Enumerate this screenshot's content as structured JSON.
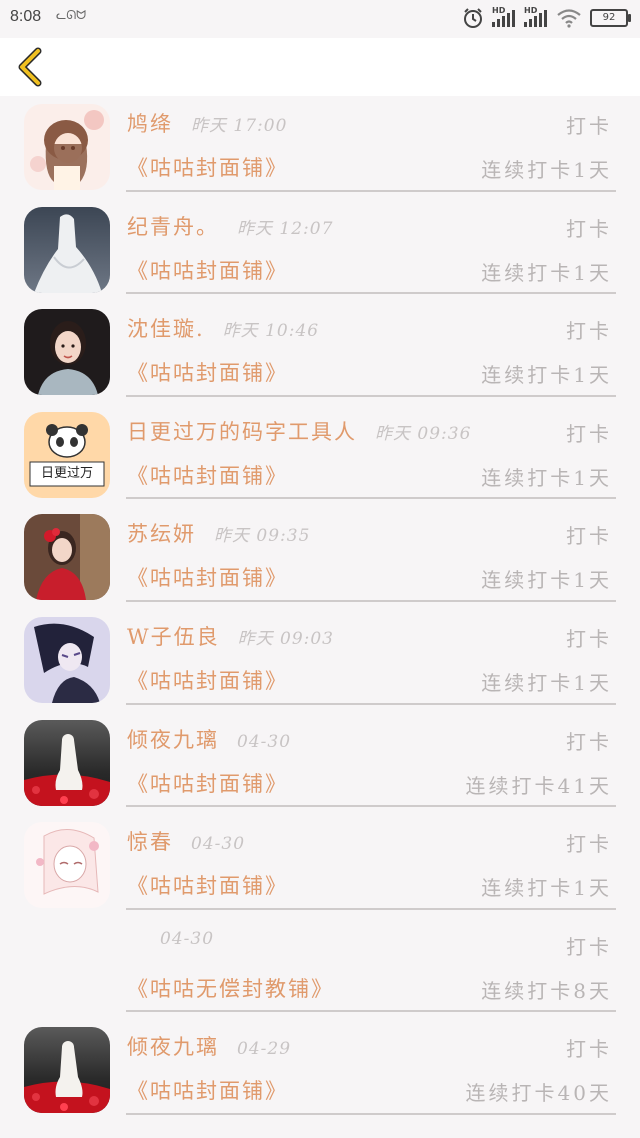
{
  "status_bar": {
    "time": "8:08",
    "notification_icon": "cat-notification-icon",
    "battery": "92",
    "icons": [
      "alarm-icon",
      "hd-signal-icon",
      "hd-signal-icon",
      "wifi-icon",
      "battery-icon"
    ]
  },
  "header": {
    "back_icon": "chevron-left-icon",
    "accent_color": "#f0c020"
  },
  "colors": {
    "name": "#e09a6c",
    "muted": "#b9b5b5",
    "time": "#c8c4c4"
  },
  "entries": [
    {
      "name": "鸠绛",
      "time": "昨天 17:00",
      "action": "打卡",
      "book": "《咕咕封面铺》",
      "streak": "连续打卡1天",
      "avatar": "anime-girl-avatar"
    },
    {
      "name": "纪青舟。",
      "time": "昨天 12:07",
      "action": "打卡",
      "book": "《咕咕封面铺》",
      "streak": "连续打卡1天",
      "avatar": "white-dress-avatar"
    },
    {
      "name": "沈佳璇.",
      "time": "昨天 10:46",
      "action": "打卡",
      "book": "《咕咕封面铺》",
      "streak": "连续打卡1天",
      "avatar": "woman-portrait-avatar"
    },
    {
      "name": "日更过万的码字工具人",
      "time": "昨天 09:36",
      "action": "打卡",
      "book": "《咕咕封面铺》",
      "streak": "连续打卡1天",
      "avatar": "panda-avatar",
      "avatar_text": "日更过万"
    },
    {
      "name": "苏纭妍",
      "time": "昨天 09:35",
      "action": "打卡",
      "book": "《咕咕封面铺》",
      "streak": "连续打卡1天",
      "avatar": "red-dress-avatar"
    },
    {
      "name": "W子伍良",
      "time": "昨天 09:03",
      "action": "打卡",
      "book": "《咕咕封面铺》",
      "streak": "连续打卡1天",
      "avatar": "anime-boy-avatar"
    },
    {
      "name": "倾夜九璃",
      "time": "04-30",
      "action": "打卡",
      "book": "《咕咕封面铺》",
      "streak": "连续打卡41天",
      "avatar": "red-flowers-avatar"
    },
    {
      "name": "惊春",
      "time": "04-30",
      "action": "打卡",
      "book": "《咕咕封面铺》",
      "streak": "连续打卡1天",
      "avatar": "sketch-girl-avatar"
    },
    {
      "name": "",
      "time": "04-30",
      "action": "打卡",
      "book": "《咕咕无偿封教铺》",
      "streak": "连续打卡8天",
      "avatar": "blank-avatar"
    },
    {
      "name": "倾夜九璃",
      "time": "04-29",
      "action": "打卡",
      "book": "《咕咕封面铺》",
      "streak": "连续打卡40天",
      "avatar": "red-flowers-avatar"
    }
  ]
}
